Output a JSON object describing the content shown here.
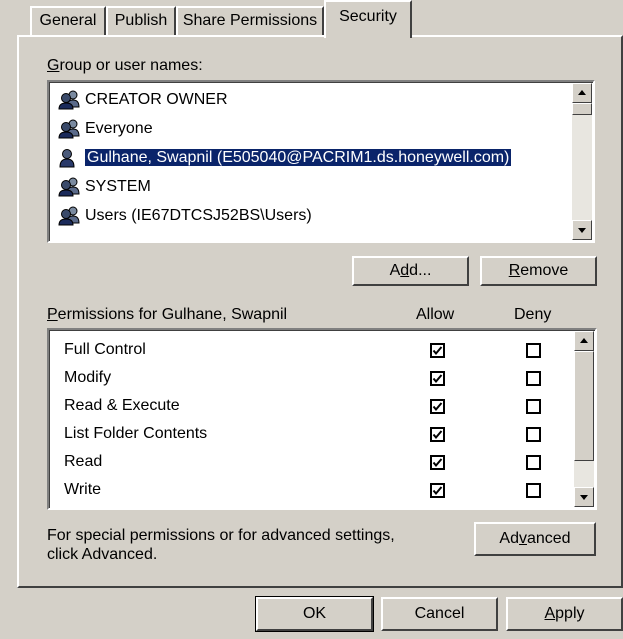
{
  "tabs": [
    {
      "label": "General"
    },
    {
      "label": "Publish"
    },
    {
      "label": "Share Permissions"
    },
    {
      "label": "Security"
    }
  ],
  "group_section": {
    "label_prefix": "G",
    "label_rest": "roup or user names:"
  },
  "users": [
    {
      "name": "CREATOR OWNER",
      "icon": "users-group-icon"
    },
    {
      "name": "Everyone",
      "icon": "users-group-icon"
    },
    {
      "name": "Gulhane, Swapnil (E505040@PACRIM1.ds.honeywell.com)",
      "icon": "user-icon",
      "selected": true
    },
    {
      "name": "SYSTEM",
      "icon": "users-group-icon"
    },
    {
      "name": "Users (IE67DTCSJ52BS\\Users)",
      "icon": "users-group-icon"
    }
  ],
  "buttons": {
    "add_pre": "A",
    "add_u": "d",
    "add_post": "d...",
    "remove_u": "R",
    "remove_rest": "emove",
    "advanced_pre": "Ad",
    "advanced_u": "v",
    "advanced_post": "anced",
    "ok": "OK",
    "cancel": "Cancel",
    "apply_u": "A",
    "apply_rest": "pply"
  },
  "permissions": {
    "label_u": "P",
    "label_rest": "ermissions for Gulhane, Swapnil",
    "allow_header": "Allow",
    "deny_header": "Deny",
    "rows": [
      {
        "name": "Full Control",
        "allow": true,
        "deny": false
      },
      {
        "name": "Modify",
        "allow": true,
        "deny": false
      },
      {
        "name": "Read & Execute",
        "allow": true,
        "deny": false
      },
      {
        "name": "List Folder Contents",
        "allow": true,
        "deny": false
      },
      {
        "name": "Read",
        "allow": true,
        "deny": false
      },
      {
        "name": "Write",
        "allow": true,
        "deny": false
      }
    ]
  },
  "special_text_line1": "For special permissions or for advanced settings,",
  "special_text_line2": "click Advanced.",
  "colors": {
    "background": "#d4d0c8",
    "selection": "#0a246a"
  }
}
